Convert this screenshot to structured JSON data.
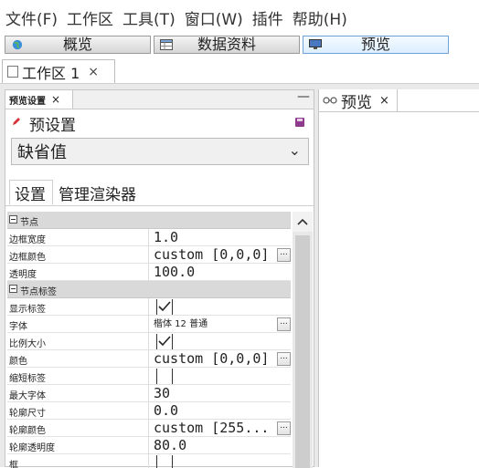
{
  "menubar": {
    "items": [
      "文件(F)",
      "工作区",
      "工具(T)",
      "窗口(W)",
      "插件",
      "帮助(H)"
    ]
  },
  "toolbar": {
    "overview_label": "概览",
    "data_label": "数据资料",
    "preview_label": "预览"
  },
  "workspace_tab": {
    "label": "工作区 1",
    "close": "×"
  },
  "left_panel": {
    "tab_label": "预览设置",
    "tab_close": "×",
    "minimize": "—",
    "preset_title": "预设置",
    "preset_value": "缺省值",
    "subtabs": [
      "设置",
      "管理渲染器"
    ]
  },
  "properties": [
    {
      "type": "category",
      "label": "节点"
    },
    {
      "type": "prop",
      "name": "边框宽度",
      "value": "1.0"
    },
    {
      "type": "prop",
      "name": "边框颜色",
      "value": "custom [0,0,0]",
      "ellipsis": true
    },
    {
      "type": "prop",
      "name": "透明度",
      "value": "100.0"
    },
    {
      "type": "category",
      "label": "节点标签"
    },
    {
      "type": "prop",
      "name": "显示标签",
      "check": true
    },
    {
      "type": "prop",
      "name": "字体",
      "value": "楷体 12 普通",
      "small": true,
      "ellipsis": true
    },
    {
      "type": "prop",
      "name": "比例大小",
      "check": true
    },
    {
      "type": "prop",
      "name": "颜色",
      "value": "custom [0,0,0]",
      "ellipsis": true
    },
    {
      "type": "prop",
      "name": "缩短标签",
      "check": false
    },
    {
      "type": "prop",
      "name": "最大字体",
      "value": "30"
    },
    {
      "type": "prop",
      "name": "轮廓尺寸",
      "value": "0.0"
    },
    {
      "type": "prop",
      "name": "轮廓颜色",
      "value": "custom [255...",
      "ellipsis": true
    },
    {
      "type": "prop",
      "name": "轮廓透明度",
      "value": "80.0"
    },
    {
      "type": "prop",
      "name": "框",
      "check": false
    }
  ],
  "right_panel": {
    "tab_label": "预览",
    "tab_close": "×"
  },
  "icons": {
    "globe": "globe-icon",
    "table": "table-icon",
    "monitor": "monitor-icon",
    "pencil": "pencil-icon",
    "save": "save-icon",
    "chevron": "chevron-down-icon",
    "scroll": "scroll-up-icon"
  },
  "colors": {
    "category_bg": "#d9d9d9",
    "active_button": "#dbeeff",
    "pencil": "#d6343a",
    "save": "#8e3b8e"
  }
}
